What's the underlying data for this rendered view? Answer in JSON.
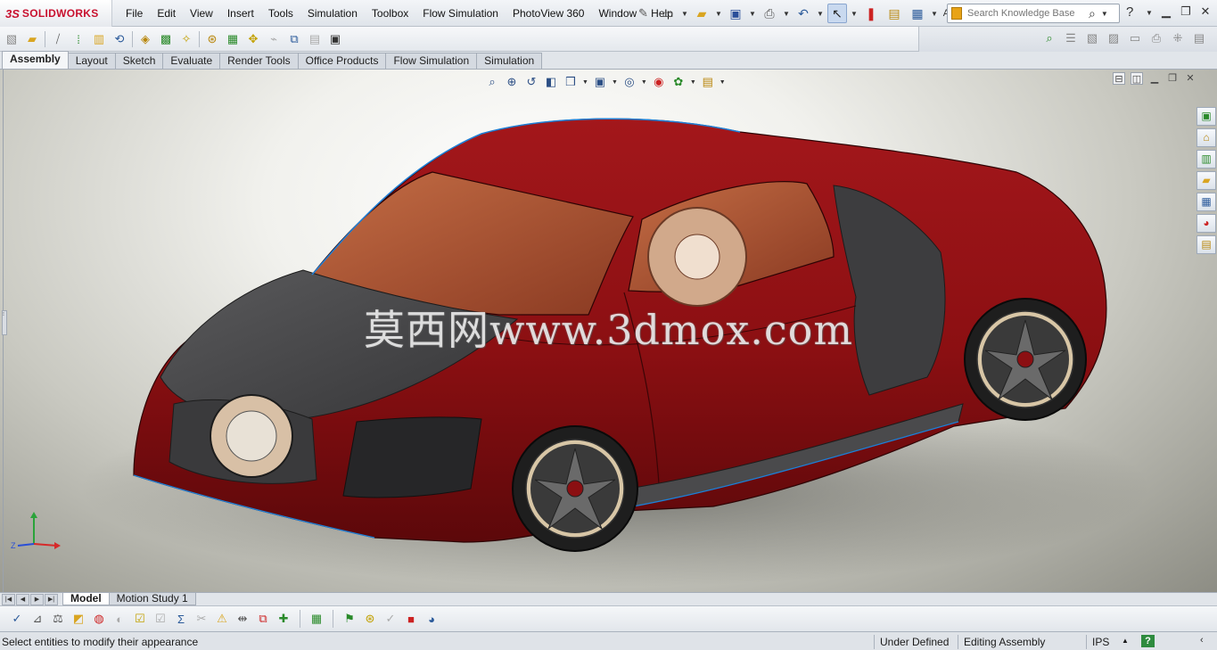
{
  "app": {
    "brand": "SOLIDWORKS",
    "brand_prefix": "3S"
  },
  "menu": {
    "items": [
      "File",
      "Edit",
      "View",
      "Insert",
      "Tools",
      "Simulation",
      "Toolbox",
      "Flow Simulation",
      "PhotoView 360",
      "Window",
      "Help"
    ]
  },
  "search": {
    "placeholder": "Search Knowledge Base"
  },
  "quick_access": {
    "overflow_label": "A..."
  },
  "command_manager": {
    "tabs": [
      "Assembly",
      "Layout",
      "Sketch",
      "Evaluate",
      "Render Tools",
      "Office Products",
      "Flow Simulation",
      "Simulation"
    ],
    "active_tab": "Assembly"
  },
  "graphics": {
    "watermark": "莫西网www.3dmox.com",
    "model_colors": {
      "body": "#8b0f12",
      "body_dark": "#5c080a",
      "hood": "#4a4a4c",
      "glass": "#b25a3a",
      "tire": "#2a2a2a",
      "rim": "#3a3a3a",
      "edge_highlight": "#1f7fd6"
    },
    "triad_axes": {
      "y_color": "#2aa33a",
      "x_color": "#d62a2a",
      "z_color": "#2a4fd6",
      "z_label": "Z"
    }
  },
  "bottom_tabs": {
    "items": [
      "Model",
      "Motion Study 1"
    ],
    "active": "Model"
  },
  "status": {
    "message": "Select entities to modify their appearance",
    "definition": "Under Defined",
    "mode": "Editing Assembly",
    "units": "IPS",
    "units_arrow": "▲",
    "help_badge": "?"
  }
}
